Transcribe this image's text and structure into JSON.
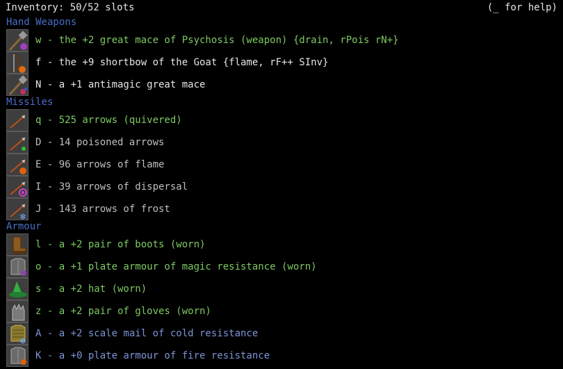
{
  "header": {
    "title": "Inventory: 50/52 slots",
    "help": "(_ for help)"
  },
  "sections": {
    "hand_weapons": "Hand Weapons",
    "missiles": "Missiles",
    "armour": "Armour"
  },
  "items": [
    {
      "text": "w - the +2 great mace of Psychosis (weapon) {drain, rPois rN+}",
      "color": "#7ec962",
      "icon": "great-mace-icon"
    },
    {
      "text": "f - the +9 shortbow of the Goat {flame, rF++ SInv}",
      "color": "#e6e6e6",
      "icon": "shortbow-icon"
    },
    {
      "text": "N - a +1 antimagic great mace",
      "color": "#e6e6e6",
      "icon": "antimagic-mace-icon"
    },
    {
      "text": "q - 525 arrows (quivered)",
      "color": "#7ec962",
      "icon": "arrow-icon"
    },
    {
      "text": "D - 14 poisoned arrows",
      "color": "#bfbfbf",
      "icon": "poison-arrow-icon"
    },
    {
      "text": "E - 96 arrows of flame",
      "color": "#bfbfbf",
      "icon": "flame-arrow-icon"
    },
    {
      "text": "I - 39 arrows of dispersal",
      "color": "#bfbfbf",
      "icon": "dispersal-arrow-icon"
    },
    {
      "text": "J - 143 arrows of frost",
      "color": "#bfbfbf",
      "icon": "frost-arrow-icon"
    },
    {
      "text": "l - a +2 pair of boots (worn)",
      "color": "#7ec962",
      "icon": "boots-icon"
    },
    {
      "text": "o - a +1 plate armour of magic resistance (worn)",
      "color": "#7ec962",
      "icon": "plate-armour-icon"
    },
    {
      "text": "s - a +2 hat (worn)",
      "color": "#7ec962",
      "icon": "hat-icon"
    },
    {
      "text": "z - a +2 pair of gloves (worn)",
      "color": "#7ec962",
      "icon": "gloves-icon"
    },
    {
      "text": "A - a +2 scale mail of cold resistance",
      "color": "#7d94d6",
      "icon": "scale-mail-icon"
    },
    {
      "text": "K - a +0 plate armour of fire resistance",
      "color": "#7d94d6",
      "icon": "fire-plate-icon"
    }
  ]
}
